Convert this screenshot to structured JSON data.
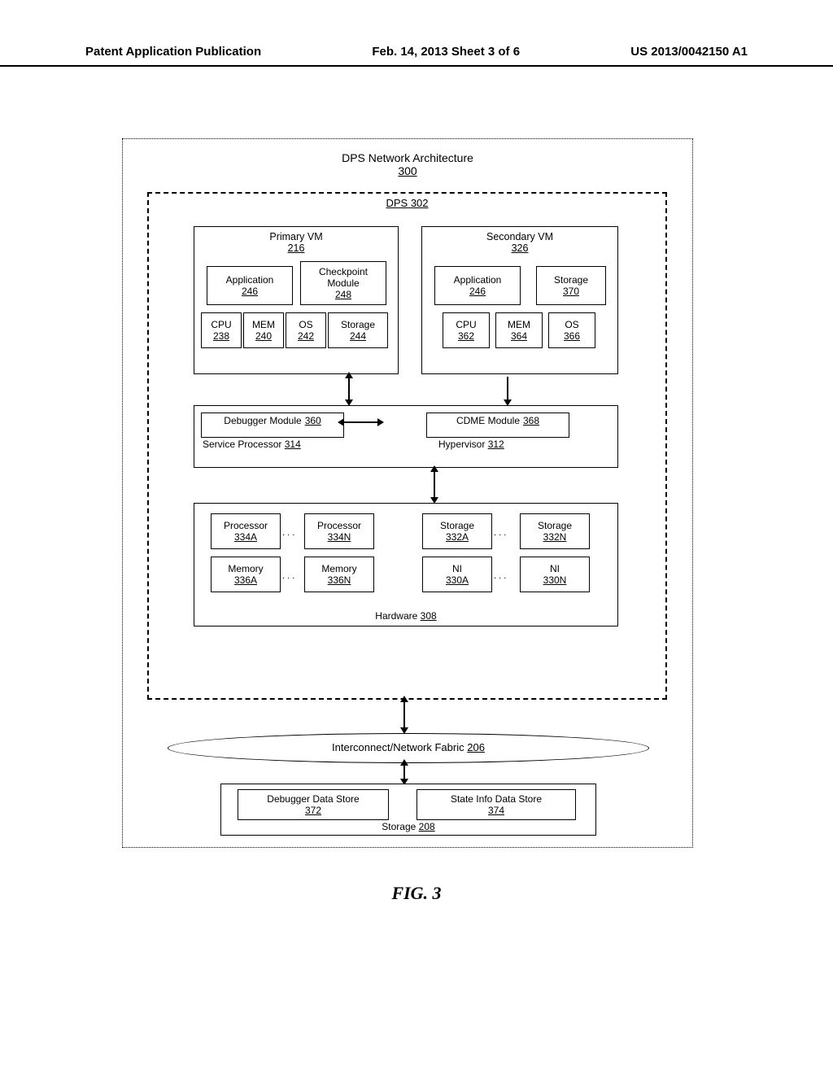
{
  "header": {
    "left": "Patent Application Publication",
    "center": "Feb. 14, 2013  Sheet 3 of 6",
    "right": "US 2013/0042150 A1"
  },
  "arch": {
    "title": "DPS Network Architecture",
    "num": "300"
  },
  "dps": {
    "label": "DPS",
    "num": "302"
  },
  "primary_vm": {
    "title": "Primary VM",
    "num": "216",
    "app": {
      "label": "Application",
      "num": "246"
    },
    "chk": {
      "label": "Checkpoint Module",
      "num": "248"
    },
    "cpu": {
      "label": "CPU",
      "num": "238"
    },
    "mem": {
      "label": "MEM",
      "num": "240"
    },
    "os": {
      "label": "OS",
      "num": "242"
    },
    "stor": {
      "label": "Storage",
      "num": "244"
    }
  },
  "secondary_vm": {
    "title": "Secondary VM",
    "num": "326",
    "app": {
      "label": "Application",
      "num": "246"
    },
    "stor": {
      "label": "Storage",
      "num": "370"
    },
    "cpu": {
      "label": "CPU",
      "num": "362"
    },
    "mem": {
      "label": "MEM",
      "num": "364"
    },
    "os": {
      "label": "OS",
      "num": "366"
    }
  },
  "hypervisor": {
    "label": "Hypervisor",
    "num": "312",
    "debugger": {
      "label": "Debugger Module",
      "num": "360"
    },
    "sp": {
      "label": "Service Processor",
      "num": "314"
    },
    "cdme": {
      "label": "CDME Module",
      "num": "368"
    }
  },
  "hardware": {
    "label": "Hardware",
    "num": "308",
    "proc_a": {
      "label": "Processor",
      "num": "334A"
    },
    "proc_n": {
      "label": "Processor",
      "num": "334N"
    },
    "stor_a": {
      "label": "Storage",
      "num": "332A"
    },
    "stor_n": {
      "label": "Storage",
      "num": "332N"
    },
    "mem_a": {
      "label": "Memory",
      "num": "336A"
    },
    "mem_n": {
      "label": "Memory",
      "num": "336N"
    },
    "ni_a": {
      "label": "NI",
      "num": "330A"
    },
    "ni_n": {
      "label": "NI",
      "num": "330N"
    }
  },
  "fabric": {
    "label": "Interconnect/Network Fabric",
    "num": "206"
  },
  "storage": {
    "label": "Storage",
    "num": "208",
    "dbg": {
      "label": "Debugger Data Store",
      "num": "372"
    },
    "state": {
      "label": "State Info Data Store",
      "num": "374"
    }
  },
  "fig": "FIG. 3",
  "ellipsis": ". . ."
}
